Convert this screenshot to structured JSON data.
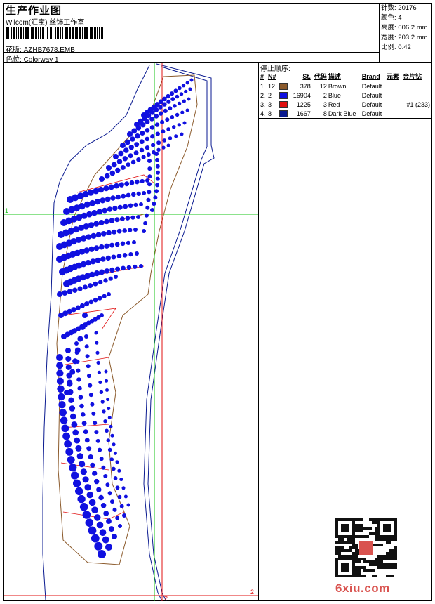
{
  "header": {
    "title": "生产作业图",
    "company": "Wilcom(汇宝) 丝饰工作室",
    "design_label": "花版:",
    "design_value": "AZHB7678.EMB",
    "colorway_label": "色位:",
    "colorway_value": "Colorway 1"
  },
  "stats": {
    "stitches_label": "针数:",
    "stitches_value": "20176",
    "colors_label": "颜色:",
    "colors_value": "4",
    "height_label": "高度:",
    "height_value": "606.2 mm",
    "width_label": "宽度:",
    "width_value": "203.2 mm",
    "scale_label": "比例:",
    "scale_value": "0.42"
  },
  "stop_sequence": {
    "title": "停止顺序:",
    "columns": [
      "#",
      "N#",
      "",
      "St.",
      "代码",
      "描述",
      "Brand",
      "元素",
      "金片钻"
    ],
    "rows": [
      {
        "idx": "1.",
        "needle": "12",
        "color": "#8B5A2B",
        "stitches": "378",
        "code": "12",
        "desc": "Brown",
        "brand": "Default",
        "element": "",
        "sequin": ""
      },
      {
        "idx": "2.",
        "needle": "2",
        "color": "#1010E0",
        "stitches": "16904",
        "code": "2",
        "desc": "Blue",
        "brand": "Default",
        "element": "",
        "sequin": ""
      },
      {
        "idx": "3.",
        "needle": "3",
        "color": "#E01010",
        "stitches": "1225",
        "code": "3",
        "desc": "Red",
        "brand": "Default",
        "element": "",
        "sequin": "#1 (233)"
      },
      {
        "idx": "4.",
        "needle": "8",
        "color": "#0A1A90",
        "stitches": "1667",
        "code": "8",
        "desc": "Dark Blue",
        "brand": "Default",
        "element": "",
        "sequin": ""
      }
    ]
  },
  "canvas": {
    "axis_label_1": "1",
    "axis_label_2": "2",
    "axis_label_2b": "2",
    "colors": {
      "blue": "#1010E0",
      "red": "#E01010",
      "navy": "#0A1A90",
      "green": "#18C418",
      "brown": "#8B5A2B"
    }
  },
  "watermark": {
    "text": "6xiu.com",
    "qr_icon": "qr-code-icon"
  }
}
